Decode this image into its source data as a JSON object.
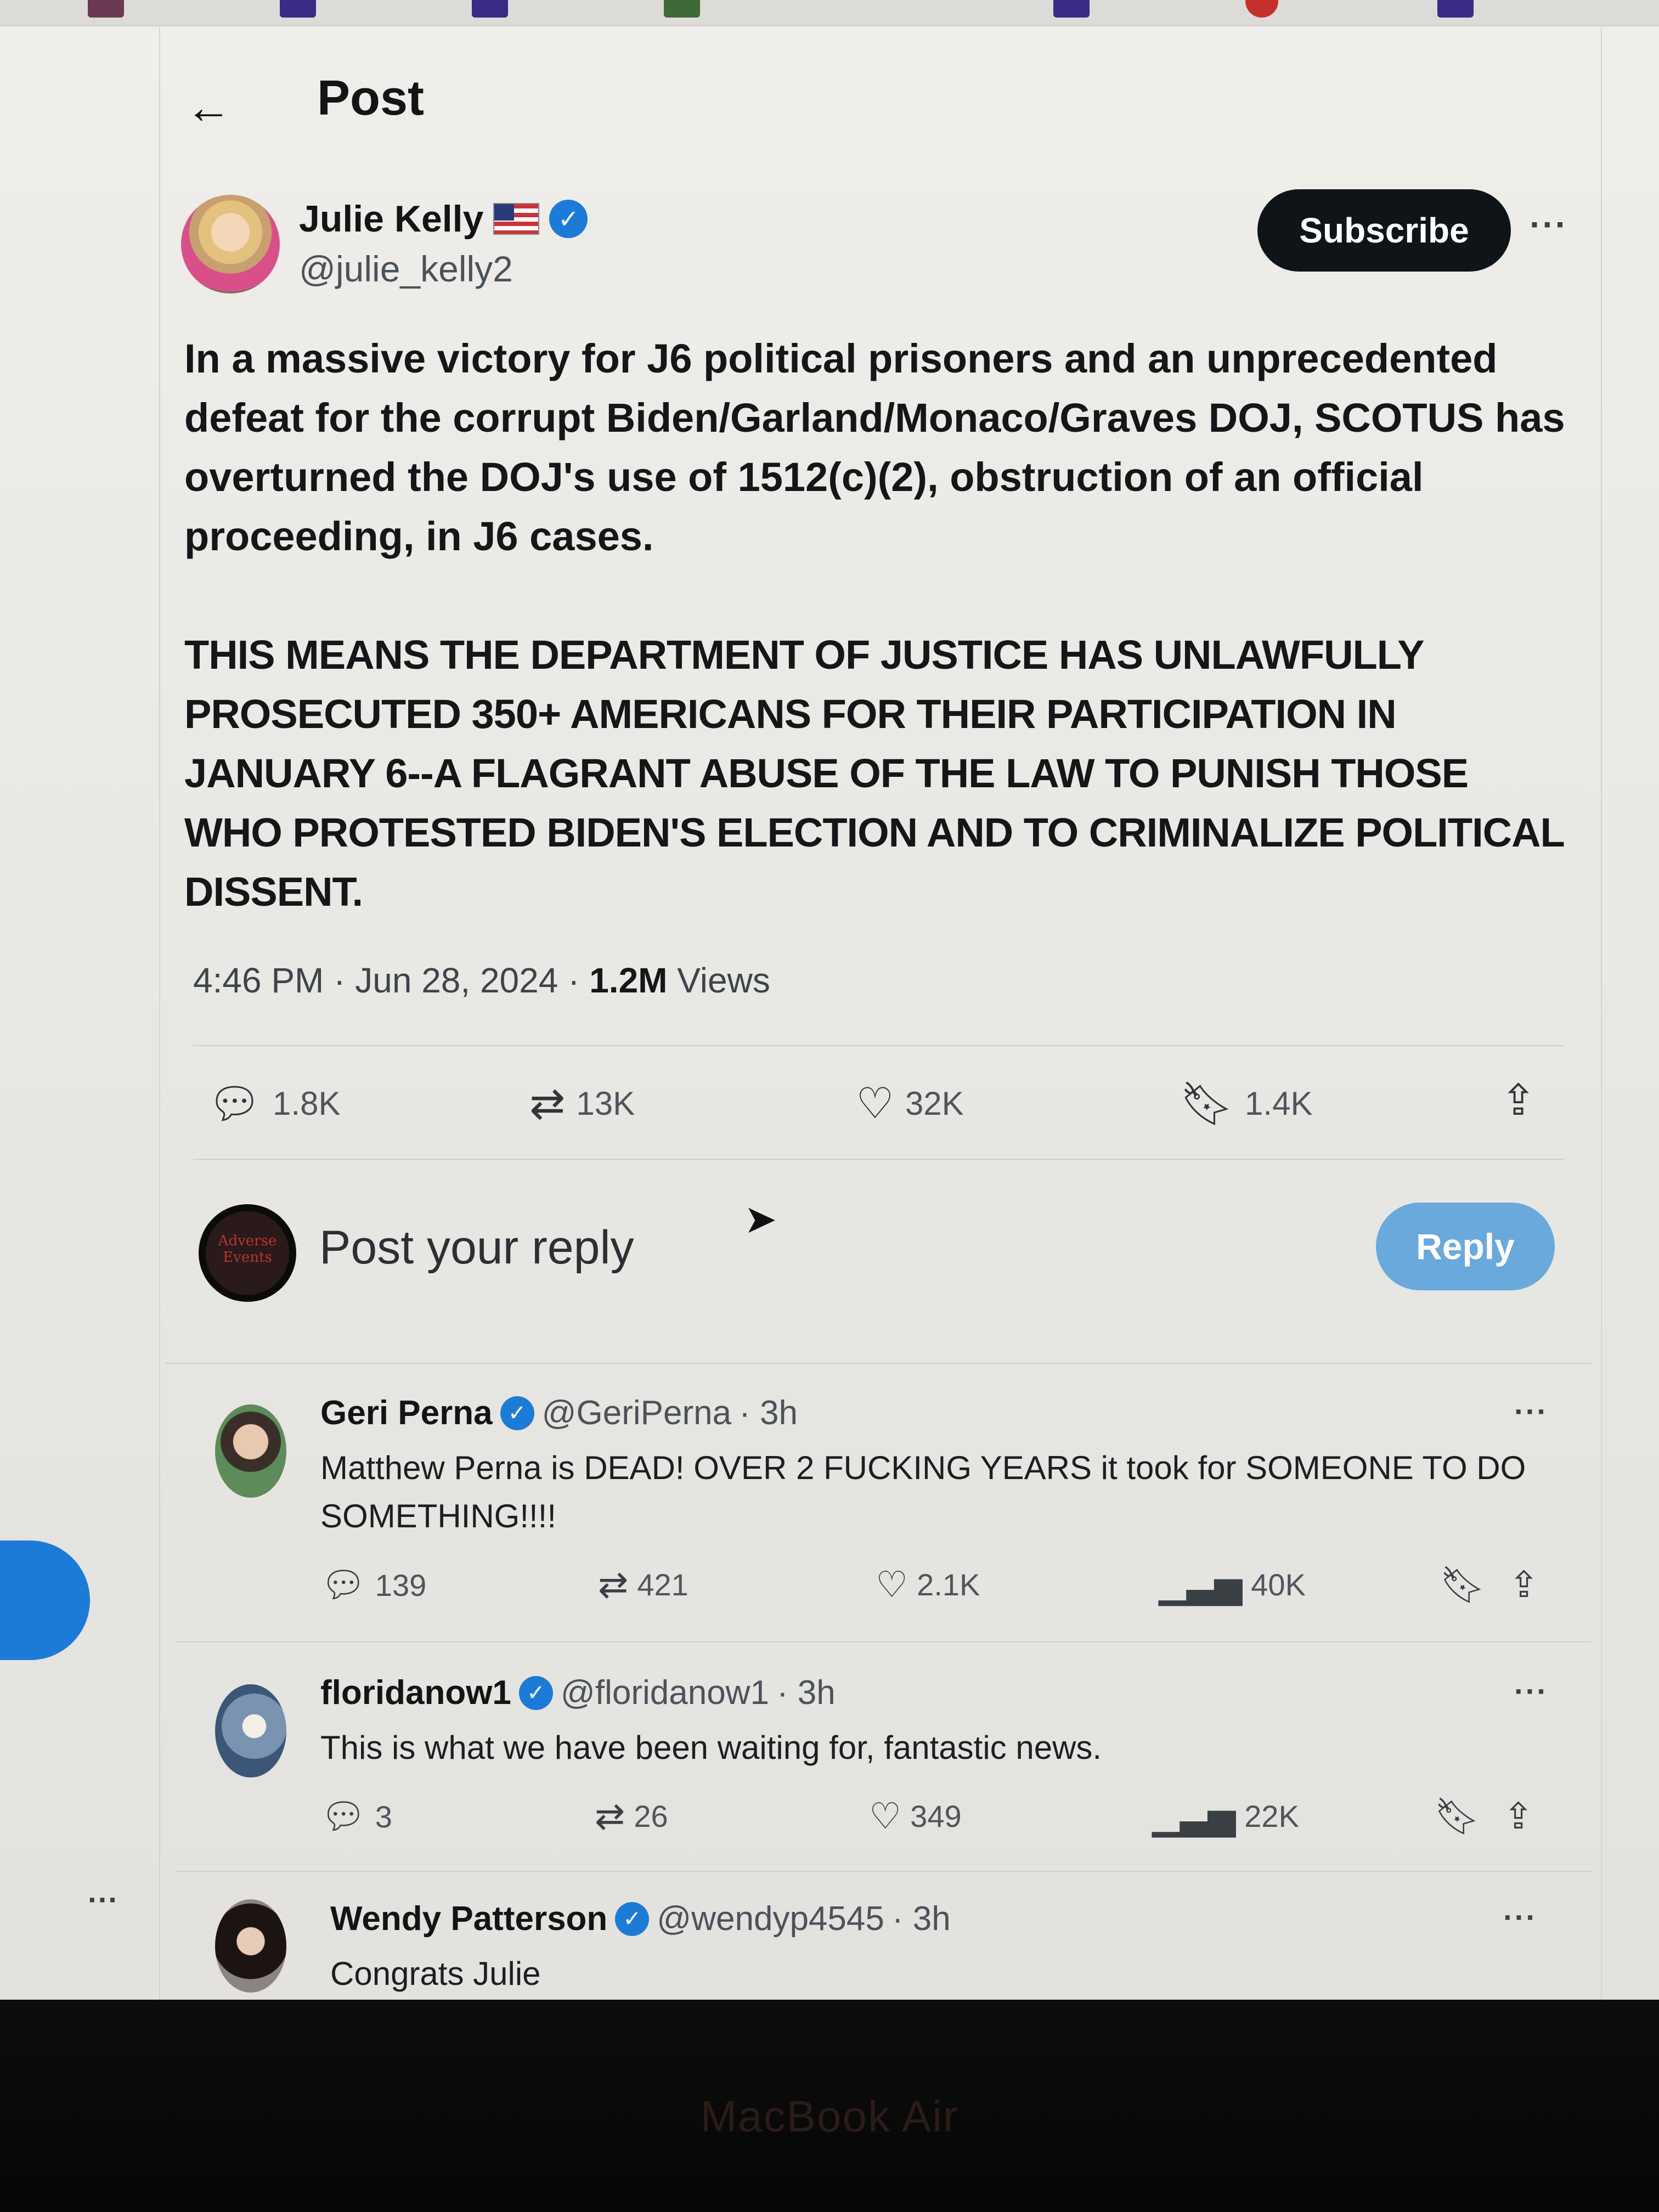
{
  "header": {
    "back_icon": "arrow-left-icon",
    "title": "Post"
  },
  "post": {
    "author": {
      "name": "Julie Kelly",
      "handle": "@julie_kelly2",
      "flag_icon": "us-flag-icon",
      "verified": true
    },
    "subscribe_label": "Subscribe",
    "more_label": "···",
    "paragraphs": [
      "In a massive victory for J6 political prisoners and an unprecedented defeat for the corrupt Biden/Garland/Monaco/Graves DOJ, SCOTUS has overturned the DOJ's use of 1512(c)(2), obstruction of an official proceeding, in J6 cases.",
      "THIS MEANS THE DEPARTMENT OF JUSTICE HAS UNLAWFULLY PROSECUTED 350+ AMERICANS FOR THEIR PARTICIPATION IN JANUARY 6--A FLAGRANT ABUSE OF THE LAW TO PUNISH THOSE WHO PROTESTED BIDEN'S ELECTION AND TO CRIMINALIZE POLITICAL DISSENT."
    ],
    "meta": {
      "time": "4:46 PM",
      "separator": "·",
      "date": "Jun 28, 2024",
      "views_count": "1.2M",
      "views_label": "Views"
    },
    "actions": {
      "replies": "1.8K",
      "reposts": "13K",
      "likes": "32K",
      "bookmarks": "1.4K"
    }
  },
  "composer": {
    "avatar_text": "Adverse Events",
    "placeholder": "Post your reply",
    "reply_label": "Reply"
  },
  "replies": [
    {
      "name": "Geri Perna",
      "handle": "@GeriPerna",
      "age": "· 3h",
      "verified": true,
      "text": "Matthew Perna is DEAD! OVER 2 FUCKING YEARS it took for SOMEONE TO DO SOMETHING!!!!",
      "replies": "139",
      "reposts": "421",
      "likes": "2.1K",
      "views": "40K"
    },
    {
      "name": "floridanow1",
      "handle": "@floridanow1",
      "age": "· 3h",
      "verified": true,
      "text": "This is what we have been waiting for, fantastic news.",
      "replies": "3",
      "reposts": "26",
      "likes": "349",
      "views": "22K"
    },
    {
      "name": "Wendy Patterson",
      "handle": "@wendyp4545",
      "age": "· 3h",
      "verified": true,
      "text": "Congrats Julie"
    }
  ],
  "sidebar": {
    "more_label": "···"
  },
  "device": {
    "label": "MacBook Air"
  },
  "colors": {
    "accent": "#1d7bd8",
    "reply_button": "#6aa9dc",
    "subscribe_button": "#0f1419"
  }
}
